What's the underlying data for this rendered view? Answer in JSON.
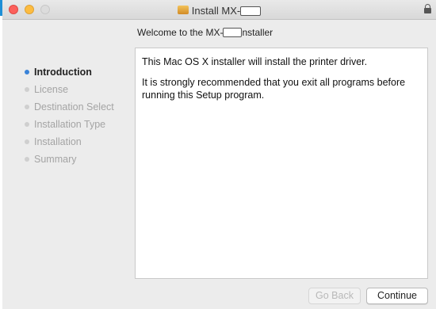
{
  "window": {
    "title_prefix": "Install MX-"
  },
  "welcome": {
    "prefix": "Welcome to the MX-",
    "suffix": "nstaller"
  },
  "sidebar": {
    "items": [
      {
        "label": "Introduction",
        "active": true
      },
      {
        "label": "License",
        "active": false
      },
      {
        "label": "Destination Select",
        "active": false
      },
      {
        "label": "Installation Type",
        "active": false
      },
      {
        "label": "Installation",
        "active": false
      },
      {
        "label": "Summary",
        "active": false
      }
    ]
  },
  "content": {
    "paragraph1": "This Mac OS X installer will install the printer driver.",
    "paragraph2": "It is strongly recommended that you exit all programs before running this Setup program."
  },
  "buttons": {
    "back_label": "Go Back",
    "continue_label": "Continue"
  },
  "colors": {
    "active_dot": "#3a83d8",
    "close": "#fc605b",
    "minimize": "#fdbc40"
  },
  "icons": {
    "title": "package-icon",
    "lock": "lock-icon"
  }
}
